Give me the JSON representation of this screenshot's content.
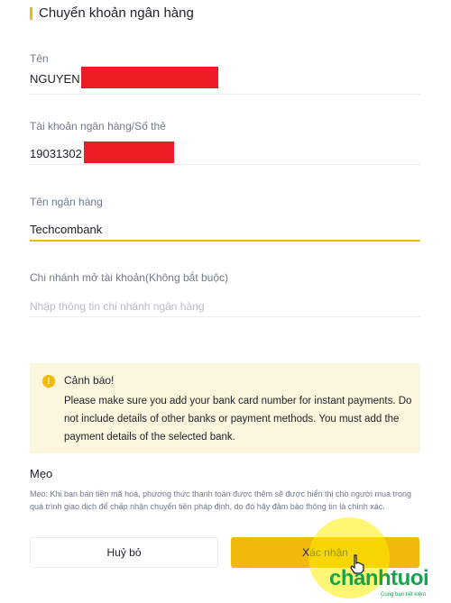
{
  "section": {
    "title": "Chuyển khoản ngân hàng"
  },
  "fields": {
    "name": {
      "label": "Tên",
      "value": "NGUYEN"
    },
    "account": {
      "label": "Tài khoản ngân hàng/Số thẻ",
      "value": "19031302"
    },
    "bank": {
      "label": "Tên ngân hàng",
      "value": "Techcombank"
    },
    "branch": {
      "label": "Chi nhánh mở tài khoản(Không bắt buộc)",
      "placeholder": "Nhập thông tin chi nhánh ngân hàng"
    }
  },
  "warning": {
    "icon": "!",
    "title": "Cảnh báo!",
    "text": "Please make sure you add your bank card number for instant payments. Do not include details of other banks or payment methods. You must add the payment details of the selected bank."
  },
  "tip": {
    "title": "Mẹo",
    "text": "Mẹo: Khi bạn bán tiền mã hoá, phương thức thanh toán được thêm sẽ được hiển thị cho người mua trong quá trình giao dịch để chấp nhận chuyển tiền pháp định, do đó hãy đảm bảo thông tin là chính xác."
  },
  "buttons": {
    "cancel": "Huỷ bỏ",
    "confirm": "Xác nhận"
  },
  "watermark": {
    "logo": "chanhtuoi",
    "tagline": "Cùng bạn tiết kiệm"
  },
  "colors": {
    "accent": "#f0b90b",
    "warning_bg": "#fdf6df",
    "redaction": "#ee1c25",
    "logo": "#16a34a"
  }
}
